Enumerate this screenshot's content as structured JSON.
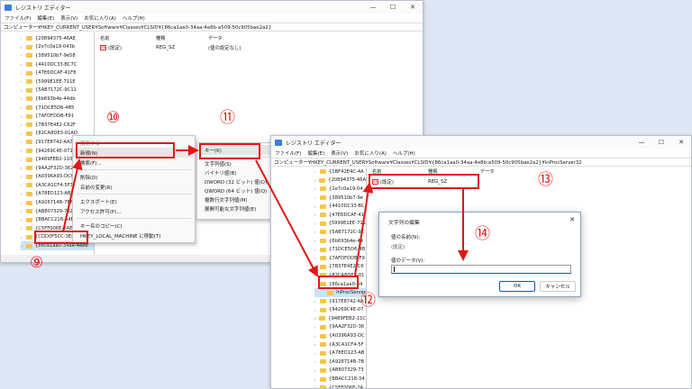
{
  "win1": {
    "title": "レジストリ エディター",
    "controls": [
      "—",
      "☐",
      "✕"
    ],
    "menu": [
      "ファイル(F)",
      "編集(E)",
      "表示(V)",
      "お気に入り(A)",
      "ヘルプ(H)"
    ],
    "address": "コンピューター¥HKEY_CURRENT_USER¥Software¥Classes¥CLSID¥{86ca1aa0-34aa-4e8b-a509-50c905bae2a2}",
    "tree": [
      "{20894375-46AE",
      "{2e7c0a19-043b",
      "{389510b7-9e58",
      "{4410DC33-BC7C",
      "{47E6DCAF-41F8",
      "{5999E1EE-711E",
      "{5AB7172C-9C11",
      "{6b693b4e-44db",
      "{71DCE5D6-4B5",
      "{7AFDFDDB-F91",
      "{7B37E4E2-C62F",
      "{82CA8DE3-01AD",
      "{917E8742-AA3B",
      "{94269C4E-071A",
      "{9489FEB2-110C",
      "{9AA2F32D-362",
      "{A0396A93-DC0",
      "{A3CA1CF4-5F3",
      "{A78ED123-AB7",
      "{A926714B-7BF",
      "{AB807329-7324",
      "{BBACC218-34E",
      "{C5FF006E-2AE",
      "{CDD0F5CC-3E8",
      "{86ca1aa0-34aa-4e8b"
    ],
    "col_name": "名前",
    "col_type": "種類",
    "col_data": "データ",
    "row_name": "(既定)",
    "row_type": "REG_SZ",
    "row_data": "(値の設定なし)"
  },
  "context_menu": {
    "items": [
      "展開する",
      "新規(N)",
      "検索(F)...",
      "削除(D)",
      "名前の変更(R)",
      "エクスポート(E)",
      "アクセス許可(P)...",
      "キー名のコピー(C)",
      "HKEY_LOCAL_MACHINE に移動(T)"
    ]
  },
  "submenu": {
    "items": [
      "キー(K)",
      "文字列値(S)",
      "バイナリ値(B)",
      "DWORD (32 ビット) 値(D)",
      "QWORD (64 ビット) 値(Q)",
      "複数行文字列値(M)",
      "展開可能な文字列値(E)"
    ]
  },
  "win2": {
    "title": "レジストリ エディター",
    "controls": [
      "—",
      "☐",
      "✕"
    ],
    "menu": [
      "ファイル(F)",
      "編集(E)",
      "表示(V)",
      "お気に入り(A)",
      "ヘルプ(H)"
    ],
    "address": "コンピューター¥HKEY_CURRENT_USER¥Software¥Classes¥CLSID¥{86ca1aa0-34aa-4e8b-a509-50c905bae2a2}¥InProcServer32",
    "tree": [
      "{1BF42E4C-4A",
      "{20894375-46A",
      "{2e7c0a19-04",
      "{389510b7-9e",
      "{4410DC33-BC",
      "{47E6DCAF-41",
      "{5999E1EE-711",
      "{5AB7172C-9C",
      "{6b693b4e-44",
      "{71DCE5D6-4B",
      "{7AFDFDDB-F9",
      "{7B37E4E2-C6",
      "{82CA8DE3-01",
      "{86ca1aa0-34",
      "InProcServer",
      "{917E8742-AA",
      "{94269C4E-07",
      "{9489FEB2-11C",
      "{9AA2F32D-36",
      "{A0396A93-DC",
      "{A3CA1CF4-5F",
      "{A78ED123-AB",
      "{A926714B-7B",
      "{AB807329-73",
      "{BBACC218-34",
      "{C5FF006E-2A",
      "{CDD0F5CC-3E"
    ],
    "col_name": "名前",
    "col_type": "種類",
    "col_data": "データ",
    "row_name": "(既定)",
    "row_type": "REG_SZ"
  },
  "dialog": {
    "title": "文字列の編集",
    "close": "✕",
    "name_label": "値の名前(N):",
    "name_value": "(既定)",
    "data_label": "値のデータ(V):",
    "data_value": "",
    "ok": "OK",
    "cancel": "キャンセル"
  },
  "steps": {
    "s9": "⑨",
    "s10": "⑩",
    "s11": "⑪",
    "s12": "⑫",
    "s13": "⑬",
    "s14": "⑭"
  },
  "colors": {
    "annotation_red": "#e01818",
    "folder_yellow": "#f3c64b",
    "selection_blue": "#cce4f7",
    "accent_blue": "#005fb8"
  }
}
